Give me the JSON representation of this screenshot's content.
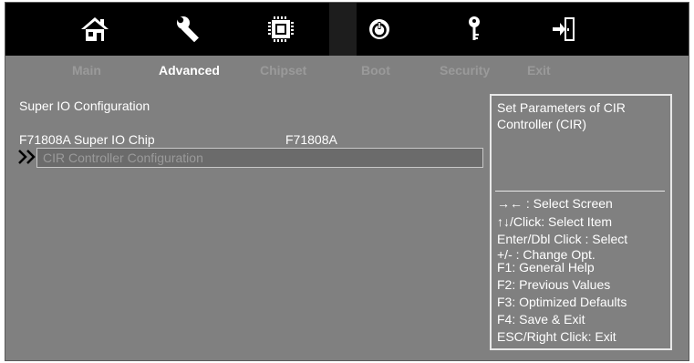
{
  "icons": [
    {
      "name": "home-icon"
    },
    {
      "name": "wrench-icon"
    },
    {
      "name": "chip-icon"
    },
    {
      "name": "power-icon"
    },
    {
      "name": "key-icon"
    },
    {
      "name": "exit-icon"
    }
  ],
  "tabs": [
    {
      "label": "Main",
      "active": false
    },
    {
      "label": "Advanced",
      "active": true
    },
    {
      "label": "Chipset",
      "active": false
    },
    {
      "label": "Boot",
      "active": false
    },
    {
      "label": "Security",
      "active": false
    },
    {
      "label": "Exit",
      "active": false
    }
  ],
  "main": {
    "section_title": "Super IO Configuration",
    "chip_label": "F71808A Super IO Chip",
    "chip_value": "F71808A",
    "selected_item": "CIR Controller Configuration"
  },
  "help": {
    "title": "Set Parameters of CIR Controller (CIR)",
    "keys": [
      "→←  : Select Screen",
      "↑↓/Click: Select Item",
      "Enter/Dbl Click : Select",
      "+/- : Change Opt.",
      "F1: General Help",
      "F2: Previous Values",
      "F3: Optimized Defaults",
      "F4: Save & Exit",
      "ESC/Right Click: Exit"
    ]
  },
  "colors": {
    "background": "#808080",
    "icon_bar": "#000000",
    "active_tab": "#ffffff",
    "inactive_tab": "#9a9a9a",
    "highlight_row": "#6b6b6b"
  }
}
